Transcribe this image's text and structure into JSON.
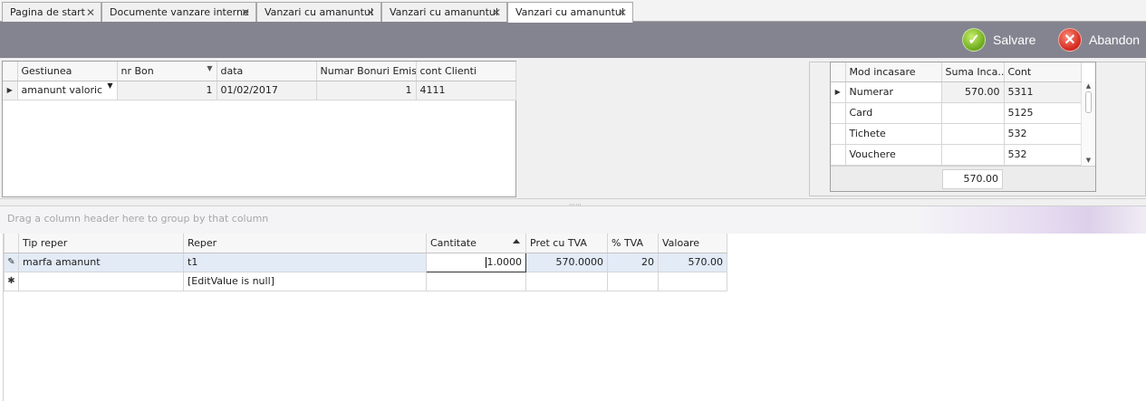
{
  "tabs": [
    {
      "label": "Pagina de start"
    },
    {
      "label": "Documente vanzare interne"
    },
    {
      "label": "Vanzari cu amanuntul"
    },
    {
      "label": "Vanzari cu amanuntul"
    },
    {
      "label": "Vanzari cu amanuntul"
    }
  ],
  "toolbar": {
    "save_label": "Salvare",
    "cancel_label": "Abandon"
  },
  "header_grid": {
    "columns": [
      "Gestiunea",
      "nr Bon",
      "data",
      "Numar Bonuri Emise",
      "cont Clienti"
    ],
    "rows": [
      {
        "gestiunea": "amanunt valoric",
        "nr_bon": "1",
        "data": "01/02/2017",
        "numar_bonuri": "1",
        "cont_clienti": "4111"
      }
    ]
  },
  "payment_grid": {
    "columns": [
      "Mod incasare",
      "Suma Inca...",
      "Cont"
    ],
    "rows": [
      {
        "mod": "Numerar",
        "suma": "570.00",
        "cont": "5311"
      },
      {
        "mod": "Card",
        "suma": "",
        "cont": "5125"
      },
      {
        "mod": "Tichete",
        "suma": "",
        "cont": "532"
      },
      {
        "mod": "Vouchere",
        "suma": "",
        "cont": "532"
      }
    ],
    "total": "570.00"
  },
  "group_panel_text": "Drag a column header here to group by that column",
  "lines_grid": {
    "columns": [
      "Tip reper",
      "Reper",
      "Cantitate",
      "Pret cu TVA",
      "% TVA",
      "Valoare"
    ],
    "rows": [
      {
        "tip_reper": "marfa amanunt",
        "reper": "t1",
        "cantitate": "1.0000",
        "pret": "570.0000",
        "tva": "20",
        "valoare": "570.00"
      }
    ],
    "new_row": {
      "reper": "[EditValue is null]"
    }
  },
  "colors": {
    "toolbar": "#848490",
    "selected_row": "#e3ebf7"
  }
}
